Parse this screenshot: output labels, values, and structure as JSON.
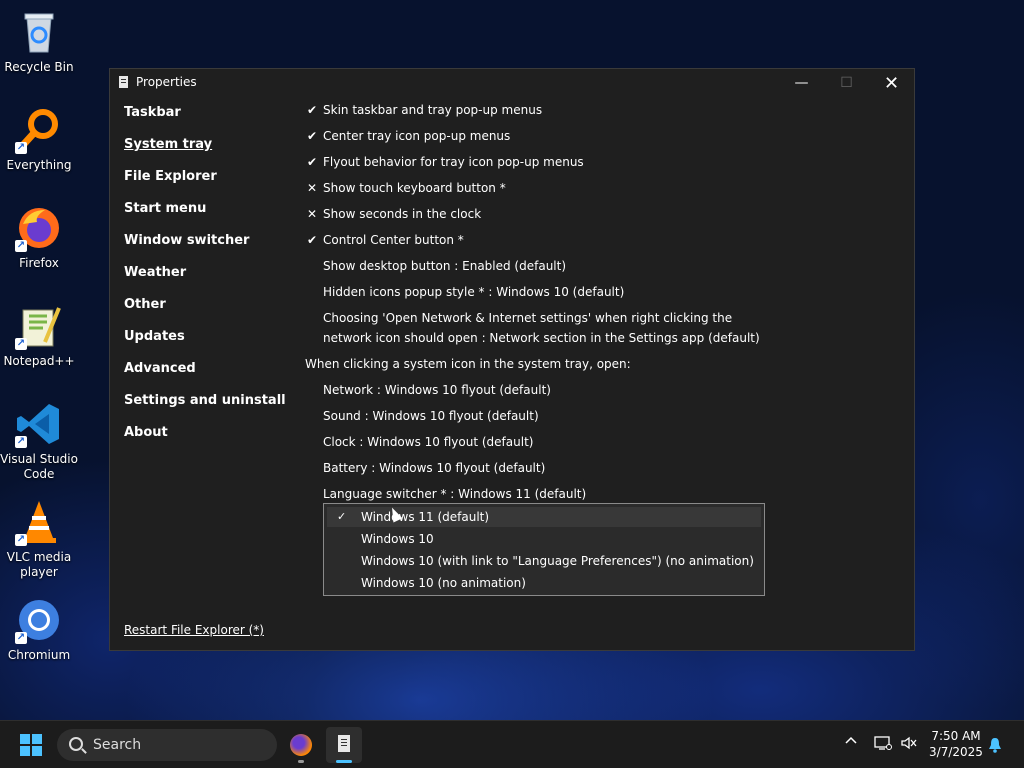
{
  "desktop": {
    "icons": [
      {
        "label": "Recycle Bin",
        "icon": "recycle-bin-icon"
      },
      {
        "label": "Everything",
        "icon": "everything-search-icon"
      },
      {
        "label": "Firefox",
        "icon": "firefox-icon"
      },
      {
        "label": "Notepad++",
        "icon": "notepad-plus-plus-icon"
      },
      {
        "label": "Visual Studio Code",
        "icon": "vscode-icon"
      },
      {
        "label": "VLC media player",
        "icon": "vlc-icon"
      },
      {
        "label": "Chromium",
        "icon": "chromium-icon"
      }
    ]
  },
  "window": {
    "title": "Properties",
    "controls": {
      "minimize": "—",
      "maximize": "☐",
      "close": "✕"
    }
  },
  "nav": {
    "items": [
      {
        "label": "Taskbar"
      },
      {
        "label": "System tray",
        "active": true
      },
      {
        "label": "File Explorer"
      },
      {
        "label": "Start menu"
      },
      {
        "label": "Window switcher"
      },
      {
        "label": "Weather"
      },
      {
        "label": "Other"
      },
      {
        "label": "Updates"
      },
      {
        "label": "Advanced"
      },
      {
        "label": "Settings and uninstall"
      },
      {
        "label": "About"
      }
    ]
  },
  "options": [
    {
      "label": "Skin taskbar and tray pop-up menus",
      "state": "checked"
    },
    {
      "label": "Center tray icon pop-up menus",
      "state": "checked"
    },
    {
      "label": "Flyout behavior for tray icon pop-up menus",
      "state": "checked"
    },
    {
      "label": "Show touch keyboard button *",
      "state": "unchecked"
    },
    {
      "label": "Show seconds in the clock",
      "state": "unchecked"
    },
    {
      "label": "Control Center button *",
      "state": "checked"
    },
    {
      "label": "Show desktop button : Enabled (default)"
    },
    {
      "label": "Hidden icons popup style * : Windows 10 (default)"
    },
    {
      "label": "Choosing 'Open Network & Internet settings' when right clicking the"
    },
    {
      "label": "network icon should open : Network section in the Settings app (default)"
    }
  ],
  "section_header": "When clicking a system icon in the system tray, open:",
  "tray_options": [
    {
      "label": "Network : Windows 10 flyout (default)"
    },
    {
      "label": "Sound : Windows 10 flyout (default)"
    },
    {
      "label": "Clock : Windows 10 flyout (default)"
    },
    {
      "label": "Battery : Windows 10 flyout (default)"
    },
    {
      "label": "Language switcher * : Windows 11 (default)"
    }
  ],
  "marks": {
    "check": "✔",
    "cross": "✕"
  },
  "dropdown": {
    "selected_mark": "✓",
    "items": [
      {
        "label": "Windows 11 (default)",
        "selected": true
      },
      {
        "label": "Windows 10"
      },
      {
        "label": "Windows 10 (with link to \"Language Preferences\") (no animation)"
      },
      {
        "label": "Windows 10 (no animation)"
      }
    ]
  },
  "restart_link": "Restart File Explorer (*)",
  "taskbar": {
    "search_placeholder": "Search",
    "apps": [
      {
        "name": "Firefox",
        "icon": "firefox-icon"
      },
      {
        "name": "Properties",
        "icon": "properties-icon"
      }
    ],
    "tray": {
      "chevron": "^",
      "time": "7:50 AM",
      "date": "3/7/2025"
    }
  },
  "colors": {
    "accent": "#4cc2ff",
    "window_bg": "#1f1f1f",
    "dropdown_bg": "#2b2b2b",
    "taskbar_bg": "#1c1c1c"
  }
}
